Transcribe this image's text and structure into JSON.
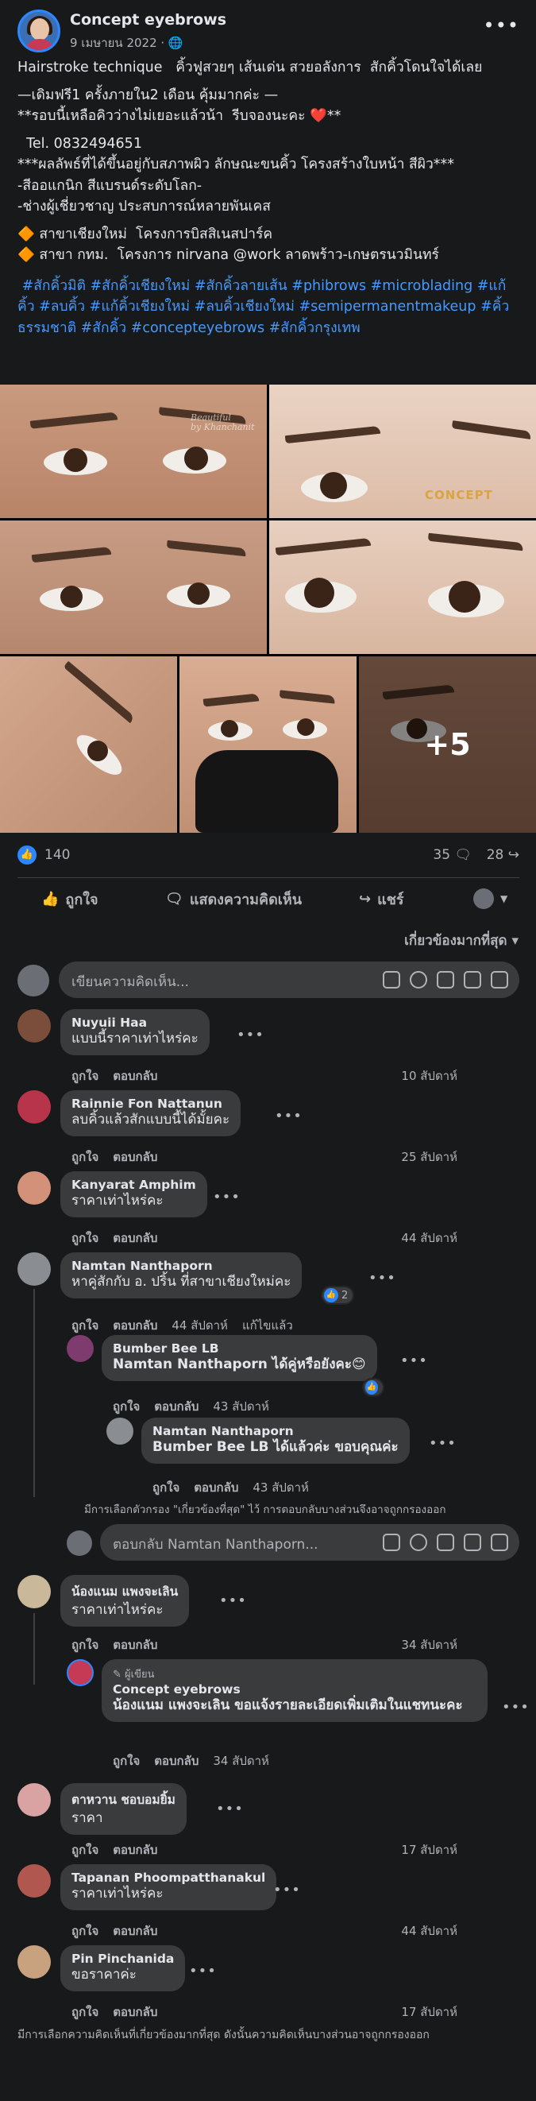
{
  "post": {
    "page_name": "Concept eyebrows",
    "date": "9 เมษายน 2022 · 🌐",
    "more": "•••",
    "text_lines": [
      "Hairstroke technique   คิ้วฟูสวยๆ เส้นเด่น สวยอลังการ  สักคิ้วโดนใจได้เลย",
      "—เดิมฟรี1 ครั้งภายใน2 เดือน คุ้มมากค่ะ —",
      "**รอบนี้เหลือคิวว่างไม่เยอะแล้วน้า  รีบจองนะคะ ❤️**",
      "",
      "  Tel. 0832494651",
      "***ผลลัพธ์ที่ได้ขึ้นอยู่กับสภาพผิว ลักษณะขนคิ้ว โครงสร้างใบหน้า สีผิว***",
      "-สีออแกนิก สีแบรนด์ระดับโลก-",
      "-ช่างผู้เชี่ยวชาญ ประสบการณ์หลายพันเคส",
      "",
      "🔶 สาขาเชียงใหม่  โครงการบิสสิเนสปาร์ค",
      "🔶 สาขา กทม.  โครงการ nirvana @work ลาดพร้าว-เกษตรนวมินทร์"
    ],
    "hashtags": " #สักคิ้วมิติ #สักคิ้วเชียงใหม่ #สักคิ้วลายเส้น #phibrows #microblading #แก้คิ้ว #ลบคิ้ว #แก้คิ้วเชียงใหม่ #ลบคิ้วเชียงใหม่ #semipermanentmakeup #คิ้วธรรมชาติ #สักคิ้ว #concepteyebrows #สักคิ้วกรุงเทพ",
    "photo_watermark": "Beautiful\nby Khanchanit",
    "brand_watermark": "CONCEPT",
    "more_photos": "+5"
  },
  "stats": {
    "likes": "140",
    "comments": "35 🗨",
    "shares": "28 ↪"
  },
  "actions": {
    "like": "ถูกใจ",
    "comment": "แสดงความคิดเห็น",
    "share": "แชร์"
  },
  "sort_label": "เกี่ยวข้องมากที่สุด ▾",
  "compose_placeholder": "เขียนความคิดเห็น...",
  "reply_placeholder": "ตอบกลับ Namtan Nanthaporn...",
  "meta_like": "ถูกใจ",
  "meta_reply": "ตอบกลับ",
  "meta_edited": "แก้ไขแล้ว",
  "comments": [
    {
      "author": "Nuyuii Haa",
      "text": "แบบนี้ราคาเท่าไหร่คะ",
      "time": "10 สัปดาห์"
    },
    {
      "author": "Rainnie Fon Nattanun",
      "text": "ลบคิ้วแล้วสักแบบนี้ได้มั้ยคะ",
      "time": "25 สัปดาห์"
    },
    {
      "author": "Kanyarat Amphim",
      "text": "ราคาเท่าไหร่คะ",
      "time": "44 สัปดาห์"
    },
    {
      "author": "Namtan Nanthaporn",
      "text": "หาคู่สักกับ อ. ปริ้น ที่สาขาเชียงใหม่คะ",
      "time": "44 สัปดาห์",
      "reactions": "2",
      "replies": [
        {
          "author": "Bumber Bee LB",
          "text": "Namtan Nanthaporn ได้คู่หรือยังคะ😊",
          "time": "43 สัปดาห์"
        },
        {
          "author": "Namtan Nanthaporn",
          "text": "Bumber Bee LB ได้แล้วค่ะ ขอบคุณค่ะ",
          "time": "43 สัปดาห์"
        }
      ],
      "note": "มีการเลือกตัวกรอง \"เกี่ยวข้องที่สุด\" ไว้ การตอบกลับบางส่วนจึงอาจถูกกรองออก"
    },
    {
      "author": "น้องแนม แพงจะเลิน",
      "text": "ราคาเท่าไหร่คะ",
      "time": "34 สัปดาห์",
      "replies": [
        {
          "author_tag": "✎ ผู้เขียน",
          "author": "Concept eyebrows",
          "text": "น้องแนม แพงจะเลิน ขอแจ้งรายละเอียดเพิ่มเติมในแชทนะคะ",
          "time": "34 สัปดาห์"
        }
      ]
    },
    {
      "author": "ตาหวาน ชอบอมยิ้ม",
      "text": "ราคา",
      "time": "17 สัปดาห์"
    },
    {
      "author": "Tapanan Phoompatthanakul",
      "text": "ราคาเท่าไหร่คะ",
      "time": "44 สัปดาห์"
    },
    {
      "author": "Pin Pinchanida",
      "text": "ขอราคาค่ะ",
      "time": "17 สัปดาห์"
    }
  ],
  "footer_note": "มีการเลือกความคิดเห็นที่เกี่ยวข้องมากที่สุด ดังนั้นความคิดเห็นบางส่วนอาจถูกกรองออก",
  "colors": {
    "background": "#18191a",
    "bubble": "#3a3b3c",
    "link": "#4599ff",
    "like_blue": "#2d88ff",
    "muted": "#b0b3b8"
  }
}
